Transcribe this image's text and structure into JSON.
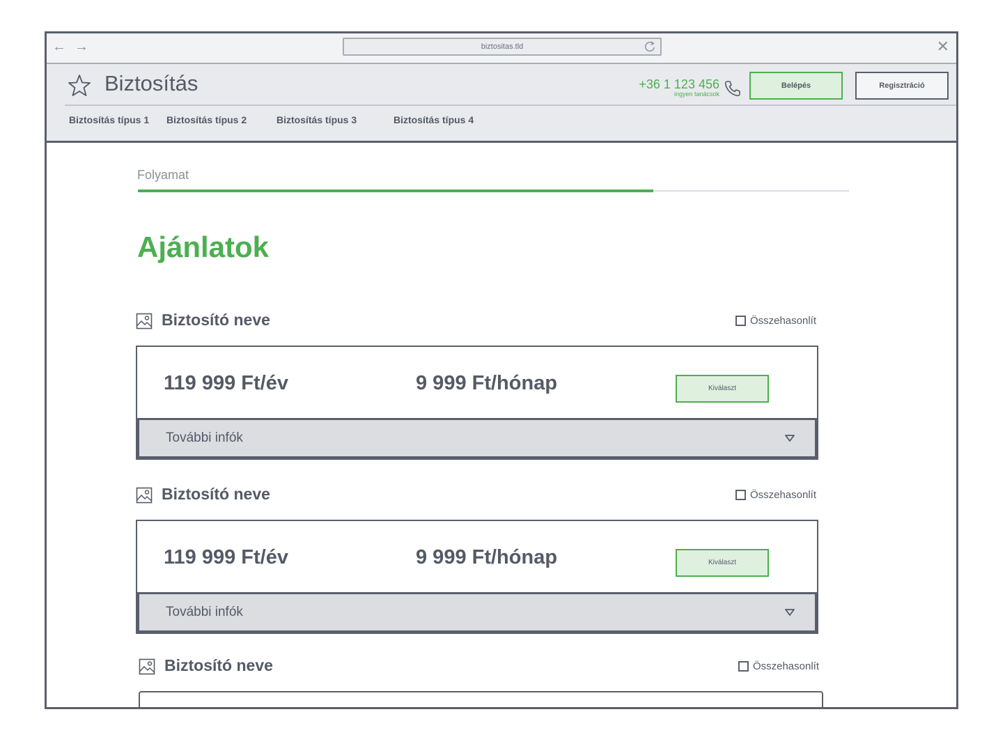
{
  "browser": {
    "url": "biztositas.tld",
    "back_glyph": "←",
    "forward_glyph": "→",
    "close_glyph": "✕"
  },
  "header": {
    "brand": "Biztosítás",
    "phone_number": "+36 1 123 456",
    "phone_subtitle": "ingyen tanácsok",
    "login_label": "Belépés",
    "register_label": "Regisztráció",
    "nav_items": [
      "Biztosítás típus 1",
      "Biztosítás típus 2",
      "Biztosítás típus 3",
      "Biztosítás típus 4"
    ]
  },
  "progress": {
    "label": "Folyamat",
    "fraction": 0.725
  },
  "page_title": "Ajánlatok",
  "offers": [
    {
      "insurer": "Biztosító neve",
      "compare_label": "Összehasonlít",
      "price_year": "119 999 Ft/év",
      "price_month": "9 999 Ft/hónap",
      "select_label": "Kiválaszt",
      "more_info_label": "További infók"
    },
    {
      "insurer": "Biztosító neve",
      "compare_label": "Összehasonlít",
      "price_year": "119 999 Ft/év",
      "price_month": "9 999 Ft/hónap",
      "select_label": "Kiválaszt",
      "more_info_label": "További infók"
    },
    {
      "insurer": "Biztosító neve",
      "compare_label": "Összehasonlít"
    }
  ],
  "colors": {
    "accent": "#4caf50",
    "text": "#545a66",
    "border": "#5a5f6b"
  }
}
